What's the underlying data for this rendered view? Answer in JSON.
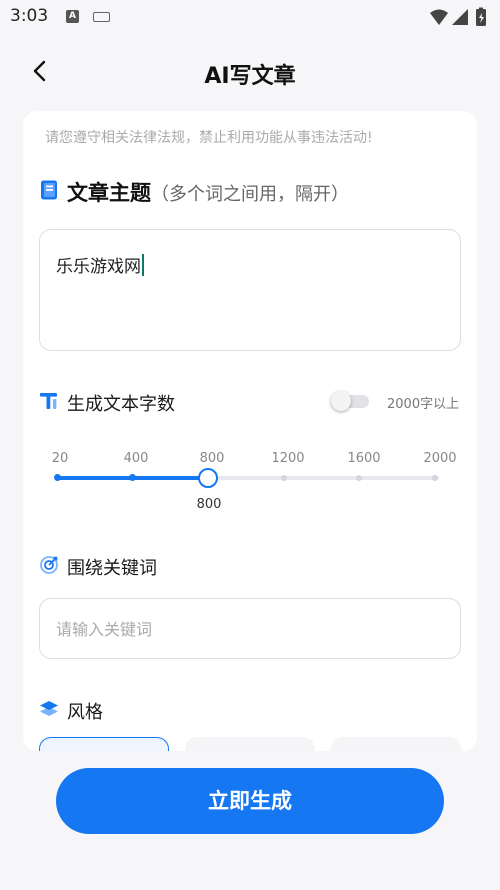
{
  "status_bar": {
    "time": "3:03",
    "app_icon": "A"
  },
  "nav": {
    "title": "AI写文章"
  },
  "notice": "请您遵守相关法律法规，禁止利用功能从事违法活动!",
  "topic": {
    "title": "文章主题",
    "hint": "（多个词之间用，隔开）",
    "value": "乐乐游戏网"
  },
  "word_count": {
    "title": "生成文本字数",
    "toggle_label": "2000字以上",
    "toggle_on": false,
    "ticks": [
      "20",
      "400",
      "800",
      "1200",
      "1600",
      "2000"
    ],
    "value": 800,
    "value_label": "800"
  },
  "keywords": {
    "title": "围绕关键词",
    "placeholder": "请输入关键词"
  },
  "style": {
    "title": "风格"
  },
  "generate_button": "立即生成",
  "colors": {
    "accent": "#1677f2",
    "caret": "#10786b"
  }
}
